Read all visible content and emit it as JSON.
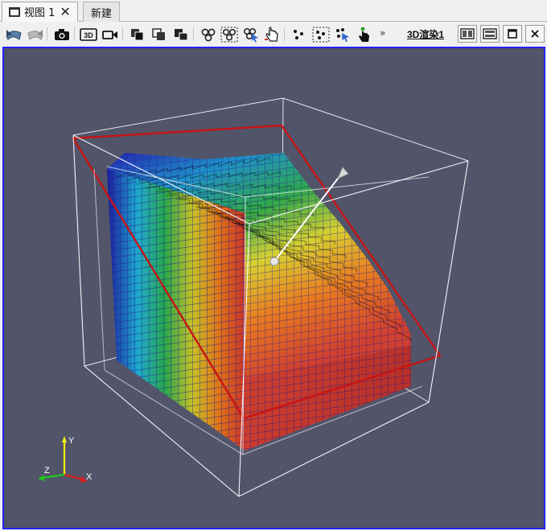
{
  "tabs": [
    {
      "label": "视图 1",
      "active": true
    },
    {
      "label": "新建",
      "active": false
    }
  ],
  "toolbar": {
    "more_label": "»",
    "view_name": "3D渲染1"
  },
  "axes_triad": {
    "x_label": "X",
    "y_label": "Y",
    "z_label": "Z"
  },
  "colors": {
    "background": "#525469",
    "viewport_border": "#2020ff",
    "bounding_box": "#ffffff",
    "slice_plane_outline": "#c81414",
    "grid_lines": "#1a1a8c",
    "arrow": "#ffffff"
  },
  "colormap": [
    "#1c1c9c",
    "#1fa8cf",
    "#2aa84a",
    "#c8c025",
    "#e07018",
    "#c8342a"
  ]
}
